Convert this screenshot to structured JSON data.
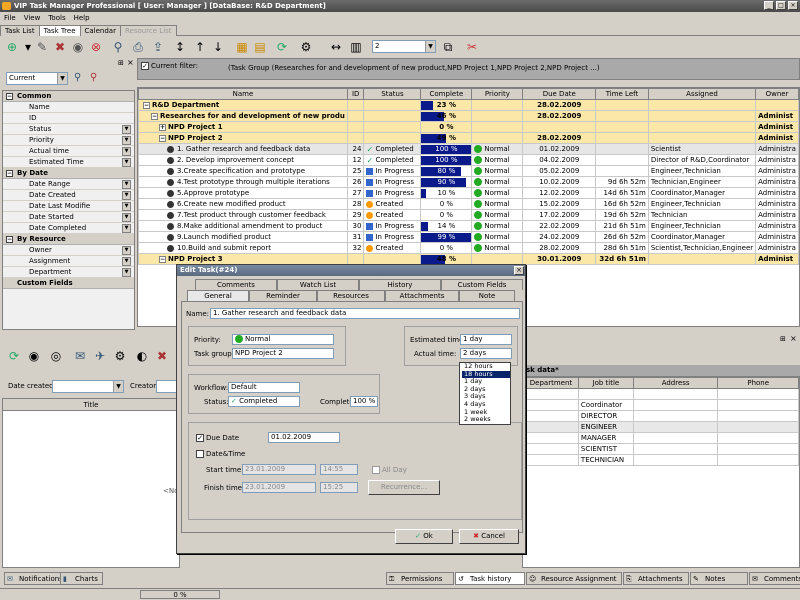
{
  "window": {
    "title": "VIP Task Manager Professional [ User: Manager ] [DataBase: R&D Department]",
    "min": "_",
    "max": "□",
    "close": "×"
  },
  "menu": [
    "File",
    "View",
    "Tools",
    "Help"
  ],
  "main_tabs": [
    "Task List",
    "Task Tree",
    "Calendar",
    "Resource List"
  ],
  "toolbar": {
    "zoom_value": "2"
  },
  "filter": {
    "checkbox_label": "Current filter:",
    "text": "(Task Group  (Researches for and development of new product,NPD Project 1,NPD Project 2,NPD Project ...)"
  },
  "left_panel": {
    "combo_value": "Current",
    "sections": [
      {
        "title": "Common",
        "items": [
          "Name",
          "ID",
          "Status",
          "Priority",
          "Actual time",
          "Estimated Time"
        ]
      },
      {
        "title": "By Date",
        "items": [
          "Date Range",
          "Date Created",
          "Date Last Modifie",
          "Date Started",
          "Date Completed"
        ]
      },
      {
        "title": "By Resource",
        "items": [
          "Owner",
          "Assignment",
          "Department"
        ]
      }
    ],
    "custom_fields": "Custom Fields"
  },
  "grid": {
    "columns": [
      "Name",
      "ID",
      "Status",
      "Complete",
      "Priority",
      "Due Date",
      "Time Left",
      "Assigned",
      "Owner"
    ],
    "rows": [
      {
        "type": "root",
        "name": "R&D Department",
        "id": "",
        "status": "",
        "complete": "23 %",
        "pct": 23,
        "priority": "",
        "due": "28.02.2009",
        "left": "",
        "assigned": "",
        "owner": ""
      },
      {
        "type": "group",
        "name": "Researches for and development of new produ",
        "id": "",
        "status": "",
        "complete": "46 %",
        "pct": 46,
        "priority": "",
        "due": "28.02.2009",
        "left": "",
        "assigned": "",
        "owner": "Administ"
      },
      {
        "type": "group",
        "name": "NPD Project 1",
        "id": "",
        "status": "",
        "complete": "0 %",
        "pct": 0,
        "priority": "",
        "due": "",
        "left": "",
        "assigned": "",
        "owner": "Administ"
      },
      {
        "type": "group",
        "name": "NPD Project 2",
        "id": "",
        "status": "",
        "complete": "49 %",
        "pct": 49,
        "priority": "",
        "due": "28.02.2009",
        "left": "",
        "assigned": "",
        "owner": "Administ"
      },
      {
        "type": "sel",
        "name": "1. Gather research and feedback data",
        "id": "24",
        "status": "Completed",
        "complete": "100 %",
        "pct": 100,
        "priority": "Normal",
        "due": "01.02.2009",
        "left": "",
        "assigned": "Scientist",
        "owner": "Administra"
      },
      {
        "type": "task",
        "name": "2. Develop improvement concept",
        "id": "12",
        "status": "Completed",
        "complete": "100 %",
        "pct": 100,
        "priority": "Normal",
        "due": "04.02.2009",
        "left": "",
        "assigned": "Director of R&D,Coordinator",
        "owner": "Administra"
      },
      {
        "type": "task",
        "name": "3.Create specification and prototype",
        "id": "25",
        "status": "In Progress",
        "complete": "80 %",
        "pct": 80,
        "priority": "Normal",
        "due": "05.02.2009",
        "left": "",
        "assigned": "Engineer,Technician",
        "owner": "Administra"
      },
      {
        "type": "task",
        "name": "4.Test prototype through multiple iterations",
        "id": "26",
        "status": "In Progress",
        "complete": "90 %",
        "pct": 90,
        "priority": "Normal",
        "due": "10.02.2009",
        "left": "9d 6h 52m",
        "assigned": "Technician,Engineer",
        "owner": "Administra"
      },
      {
        "type": "task",
        "name": "5.Approve prototype",
        "id": "27",
        "status": "In Progress",
        "complete": "10 %",
        "pct": 10,
        "priority": "Normal",
        "due": "12.02.2009",
        "left": "14d 6h 51m",
        "assigned": "Coordinator,Manager",
        "owner": "Administra"
      },
      {
        "type": "task",
        "name": "6.Create new modified product",
        "id": "28",
        "status": "Created",
        "complete": "0 %",
        "pct": 0,
        "priority": "Normal",
        "due": "15.02.2009",
        "left": "16d 6h 52m",
        "assigned": "Engineer,Technician",
        "owner": "Administra"
      },
      {
        "type": "task",
        "name": "7.Test product through customer feedback",
        "id": "29",
        "status": "Created",
        "complete": "0 %",
        "pct": 0,
        "priority": "Normal",
        "due": "17.02.2009",
        "left": "19d 6h 52m",
        "assigned": "Technician",
        "owner": "Administra"
      },
      {
        "type": "task",
        "name": "8.Make additional amendment to product",
        "id": "30",
        "status": "In Progress",
        "complete": "14 %",
        "pct": 14,
        "priority": "Normal",
        "due": "22.02.2009",
        "left": "21d 6h 51m",
        "assigned": "Engineer,Technician",
        "owner": "Administra"
      },
      {
        "type": "task",
        "name": "9.Launch modified product",
        "id": "31",
        "status": "In Progress",
        "complete": "99 %",
        "pct": 99,
        "priority": "Normal",
        "due": "24.02.2009",
        "left": "26d 6h 52m",
        "assigned": "Coordinator,Manager",
        "owner": "Administra"
      },
      {
        "type": "task",
        "name": "10.Build and submit report",
        "id": "32",
        "status": "Created",
        "complete": "0 %",
        "pct": 0,
        "priority": "Normal",
        "due": "28.02.2009",
        "left": "28d 6h 51m",
        "assigned": "Scientist,Technician,Engineer",
        "owner": "Administra"
      },
      {
        "type": "group",
        "name": "NPD Project 3",
        "id": "",
        "status": "",
        "complete": "48 %",
        "pct": 48,
        "priority": "",
        "due": "30.01.2009",
        "left": "32d 6h 51m",
        "assigned": "",
        "owner": "Administ"
      }
    ]
  },
  "lower_left": {
    "date_created_label": "Date created:",
    "creator_label": "Creator:",
    "title_col": "Title",
    "empty_text": "<No"
  },
  "lower_right": {
    "header": "sk data*",
    "columns": [
      "Department",
      "Job title",
      "Address",
      "Phone"
    ],
    "job_titles": [
      "",
      "Coordinator",
      "DIRECTOR",
      "ENGINEER",
      "MANAGER",
      "SCIENTIST",
      "TECHNICIAN"
    ]
  },
  "dialog": {
    "title": "Edit Task(#24)",
    "tabs_row1": [
      "Comments",
      "Watch List",
      "History",
      "Custom Fields"
    ],
    "tabs_row2": [
      "General",
      "Reminder",
      "Resources",
      "Attachments",
      "Note"
    ],
    "name_label": "Name:",
    "name_value": "1. Gather research and feedback data",
    "priority_label": "Priority:",
    "priority_value": "Normal",
    "taskgroup_label": "Task group:",
    "taskgroup_value": "NPD Project 2",
    "est_label": "Estimated time:",
    "est_value": "1 day",
    "actual_label": "Actual time:",
    "actual_value": "2 days",
    "actual_options": [
      "12 hours",
      "18 hours",
      "1 day",
      "2 days",
      "3 days",
      "4 days",
      "1 week",
      "2 weeks"
    ],
    "actual_highlight": "18 hours",
    "workflow_label": "Workflow:",
    "workflow_value": "Default",
    "status_label": "Status:",
    "status_value": "Completed",
    "complete_label": "Complete:",
    "complete_value": "100 %",
    "due_label": "Due Date",
    "due_value": "01.02.2009",
    "datetime_label": "Date&Time",
    "start_label": "Start time:",
    "start_date": "23.01.2009",
    "start_time": "14:55",
    "allday_label": "All Day",
    "finish_label": "Finish time:",
    "finish_date": "23.01.2009",
    "finish_time": "15:25",
    "recurrence_label": "Recurrence...",
    "ok_label": "Ok",
    "cancel_label": "Cancel"
  },
  "bottom_tabs_left": [
    "Notifications",
    "Charts"
  ],
  "bottom_tabs_right": [
    "Permissions",
    "Task history",
    "Resource Assignment",
    "Attachments",
    "Notes",
    "Comments"
  ],
  "status_bar": {
    "progress_text": "0 %"
  }
}
